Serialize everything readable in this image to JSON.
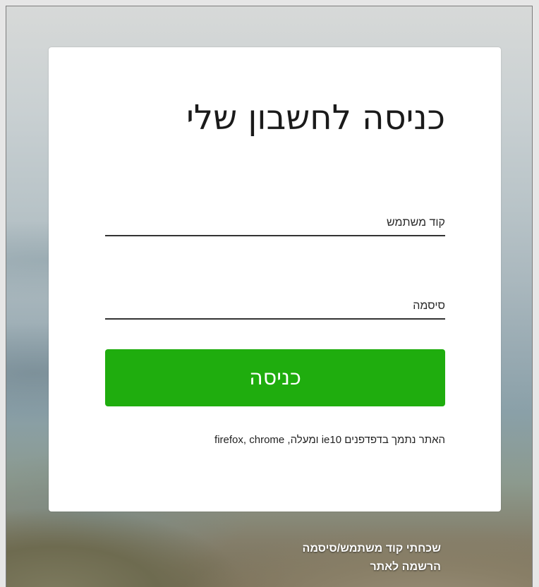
{
  "login": {
    "title": "כניסה לחשבון שלי",
    "username_placeholder": "קוד משתמש",
    "username_value": "",
    "password_placeholder": "סיסמה",
    "password_value": "",
    "submit_label": "כניסה",
    "browser_support_note": "האתר נתמך בדפדפנים ie10 ומעלה, firefox, chrome"
  },
  "links": {
    "forgot_credentials": "שכחתי קוד משתמש/סיסמה",
    "register": "הרשמה לאתר"
  },
  "colors": {
    "accent_button": "#1fad0e",
    "card_background": "#ffffff",
    "link_text": "#ffffff"
  }
}
